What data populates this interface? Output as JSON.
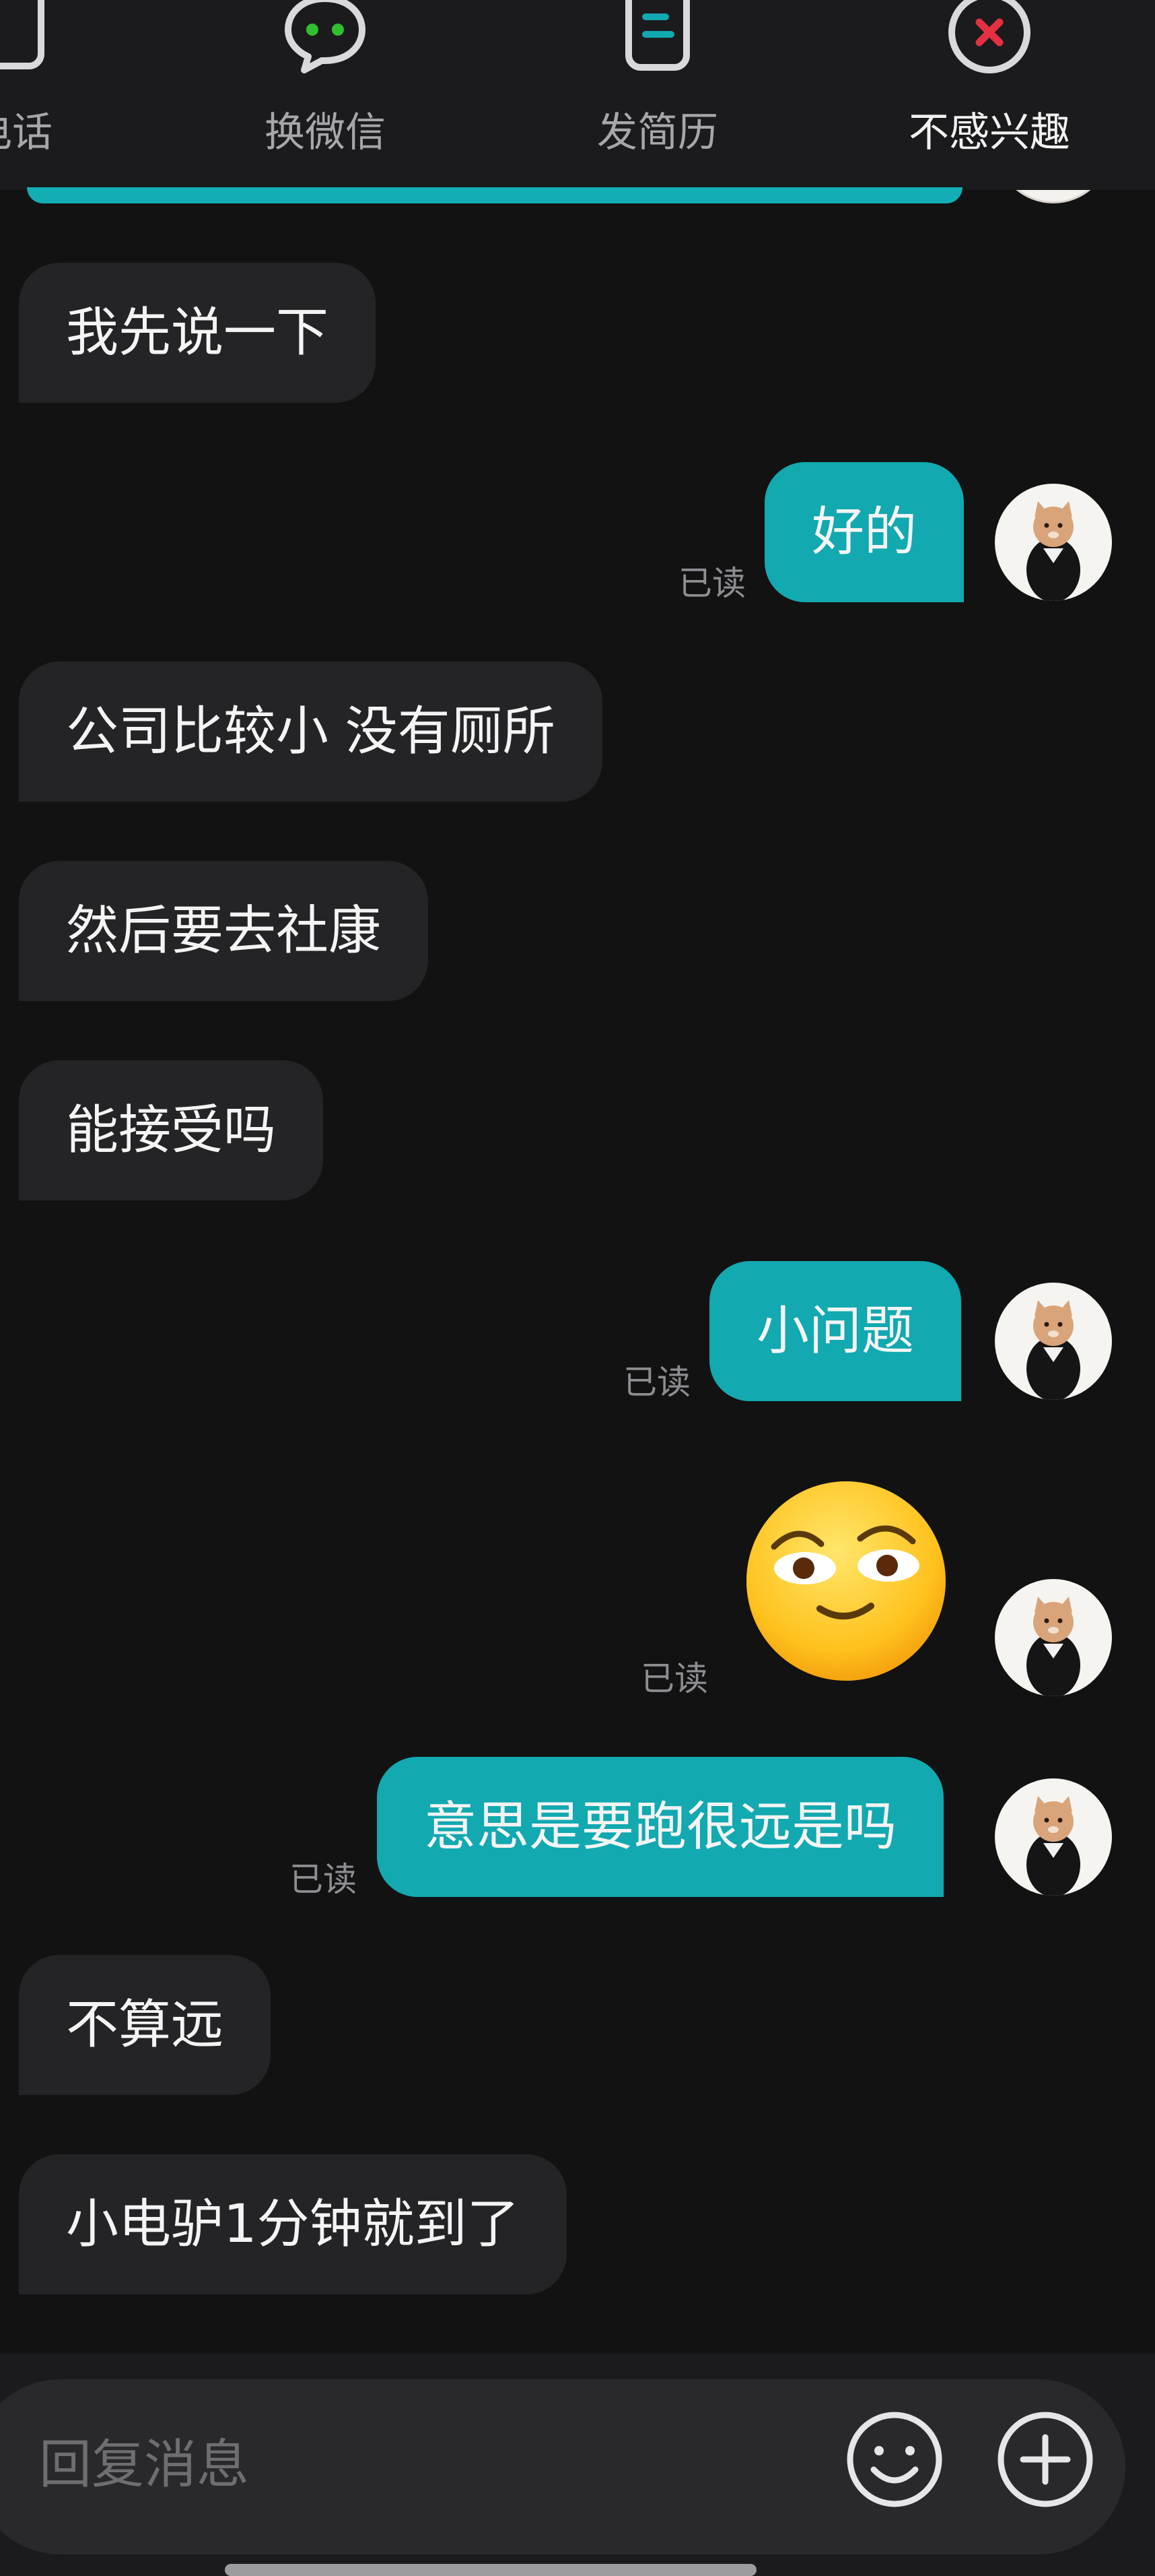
{
  "top_actions": [
    {
      "label": "电话",
      "icon": "phone-icon"
    },
    {
      "label": "换微信",
      "icon": "wechat-icon"
    },
    {
      "label": "发简历",
      "icon": "resume-icon"
    },
    {
      "label": "不感兴趣",
      "icon": "not-interested-icon"
    }
  ],
  "messages": [
    {
      "side": "in",
      "text": "我先说一下"
    },
    {
      "side": "out",
      "text": "好的",
      "status": "已读"
    },
    {
      "side": "in",
      "text": "公司比较小 没有厕所"
    },
    {
      "side": "in",
      "text": "然后要去社康"
    },
    {
      "side": "in",
      "text": "能接受吗"
    },
    {
      "side": "out",
      "text": "小问题",
      "status": "已读"
    },
    {
      "side": "out",
      "sticker": "smirk-emoji",
      "status": "已读"
    },
    {
      "side": "out",
      "text": "意思是要跑很远是吗",
      "status": "已读"
    },
    {
      "side": "in",
      "text": "不算远"
    },
    {
      "side": "in",
      "text": "小电驴1分钟就到了"
    }
  ],
  "input": {
    "placeholder": "回复消息"
  },
  "icons": {
    "emoji_button": "emoji-icon",
    "add_button": "plus-icon"
  },
  "colors": {
    "background": "#121212",
    "outgoing_bubble": "#12a9b0",
    "incoming_bubble": "#242427",
    "read_status": "#8d8d92",
    "close_accent": "#e53041",
    "wechat_accent": "#2fbf2f",
    "resume_accent": "#12a9b0"
  }
}
